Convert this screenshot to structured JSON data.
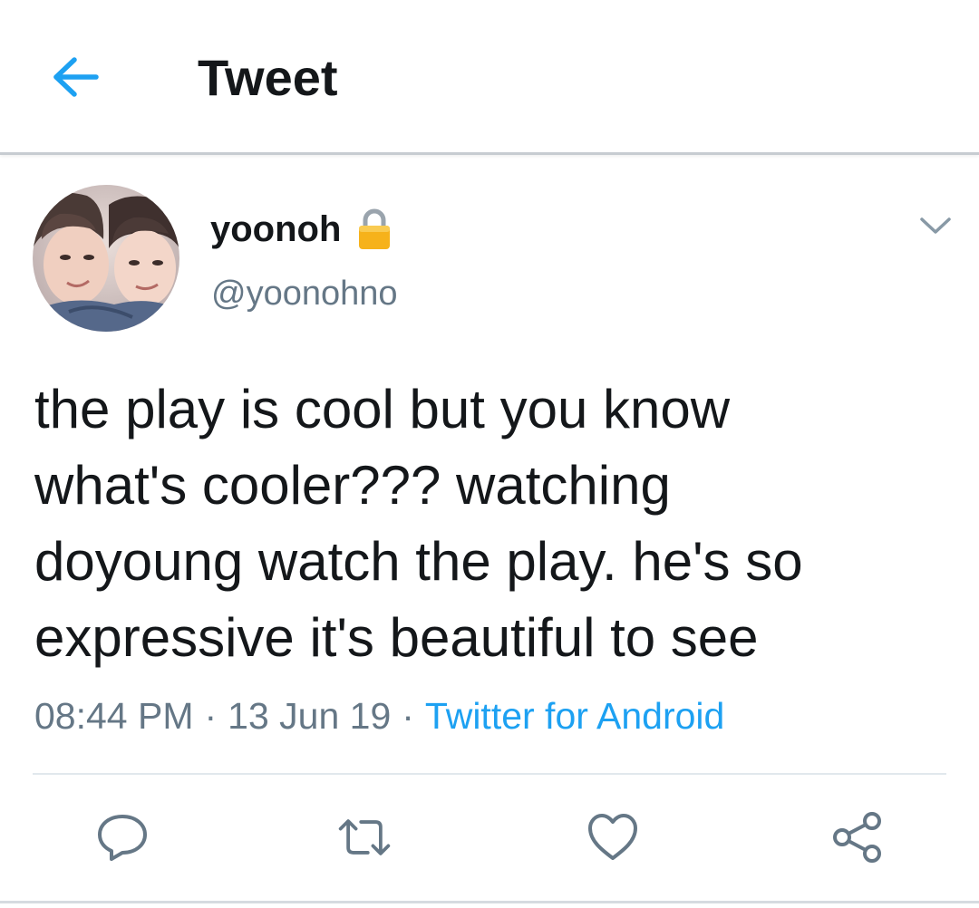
{
  "header": {
    "title": "Tweet",
    "back_icon": "arrow-left-icon"
  },
  "tweet": {
    "display_name": "yoonoh",
    "protected_icon": "lock-icon",
    "handle": "@yoonohno",
    "text": "the play is cool but you know\nwhat's cooler??? watching\ndoyoung watch the play. he's so\nexpressive it's beautiful to see",
    "time": "08:44 PM",
    "separator": "·",
    "date": "13 Jun 19",
    "source": "Twitter for Android",
    "menu_icon": "chevron-down-icon"
  },
  "actions": [
    {
      "icon": "reply-icon"
    },
    {
      "icon": "retweet-icon"
    },
    {
      "icon": "like-icon"
    },
    {
      "icon": "share-icon"
    }
  ],
  "colors": {
    "accent": "#1da1f2",
    "text_primary": "#14171a",
    "text_secondary": "#657786",
    "icon_gray": "#657786",
    "divider": "#e1e8ed"
  }
}
